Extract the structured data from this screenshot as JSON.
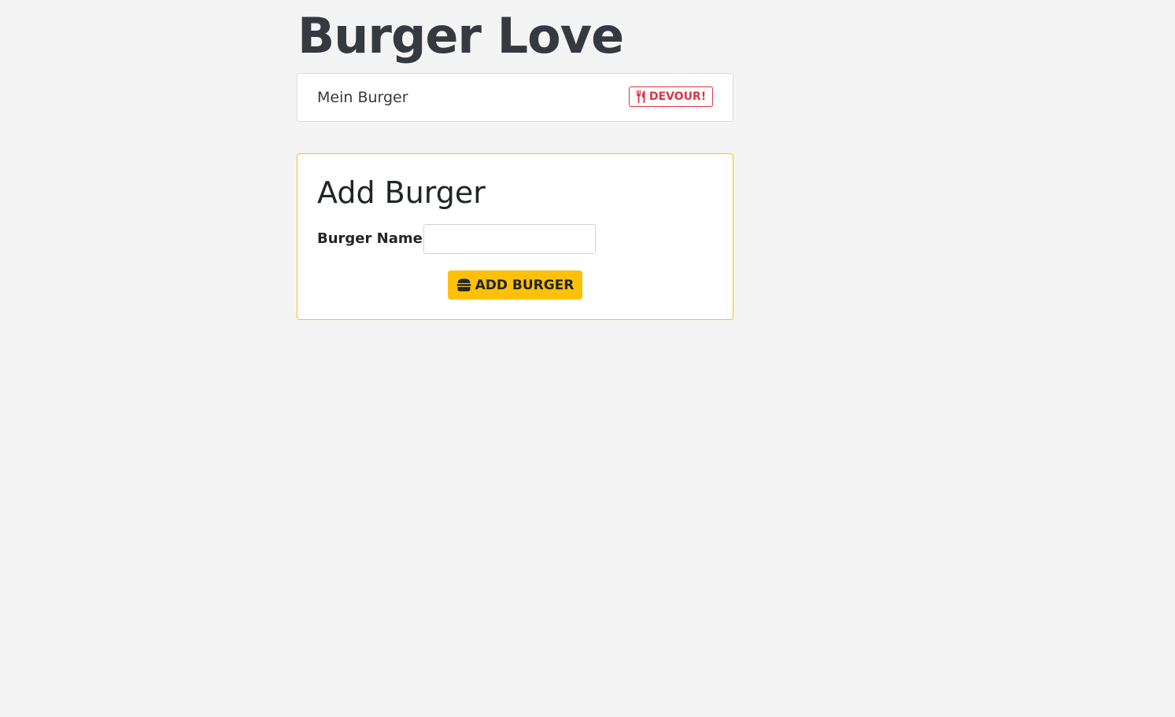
{
  "header": {
    "title": "Burger Love"
  },
  "burgers": {
    "items": [
      {
        "name": "Mein Burger",
        "action_label": "DEVOUR!",
        "action_icon": "utensils-icon"
      }
    ]
  },
  "add_form": {
    "heading": "Add Burger",
    "name_label": "Burger Name",
    "name_value": "",
    "name_placeholder": "",
    "submit_label": "ADD BURGER",
    "submit_icon": "hamburger-icon"
  },
  "colors": {
    "background": "#f4f4f4",
    "title": "#343a40",
    "devour_accent": "#dc3545",
    "add_accent": "#ffc107"
  }
}
